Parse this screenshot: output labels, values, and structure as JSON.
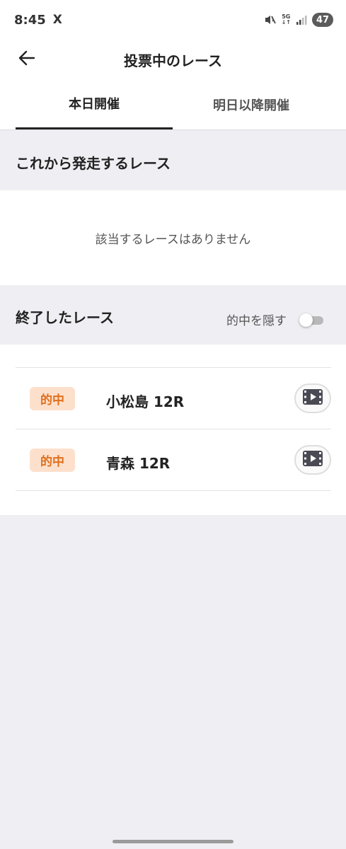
{
  "status_bar": {
    "time": "8:45",
    "app_icon": "X",
    "network_top": "5G",
    "network_bottom": "↓↑",
    "battery": "47"
  },
  "header": {
    "title": "投票中のレース",
    "back_icon": "arrow-left-icon"
  },
  "tabs": [
    {
      "label": "本日開催",
      "selected": true
    },
    {
      "label": "明日以降開催",
      "selected": false
    }
  ],
  "upcoming": {
    "title": "これから発走するレース",
    "empty_text": "該当するレースはありません"
  },
  "finished": {
    "title": "終了したレース",
    "hide_hits_label": "的中を隠す",
    "hide_hits_on": false,
    "races": [
      {
        "badge": "的中",
        "name": "小松島 12R",
        "video_icon": "video-icon"
      },
      {
        "badge": "的中",
        "name": "青森 12R",
        "video_icon": "video-icon"
      }
    ]
  },
  "colors": {
    "accent_orange": "#e0701e",
    "badge_bg": "#fde0cc",
    "page_bg": "#efeef3"
  }
}
